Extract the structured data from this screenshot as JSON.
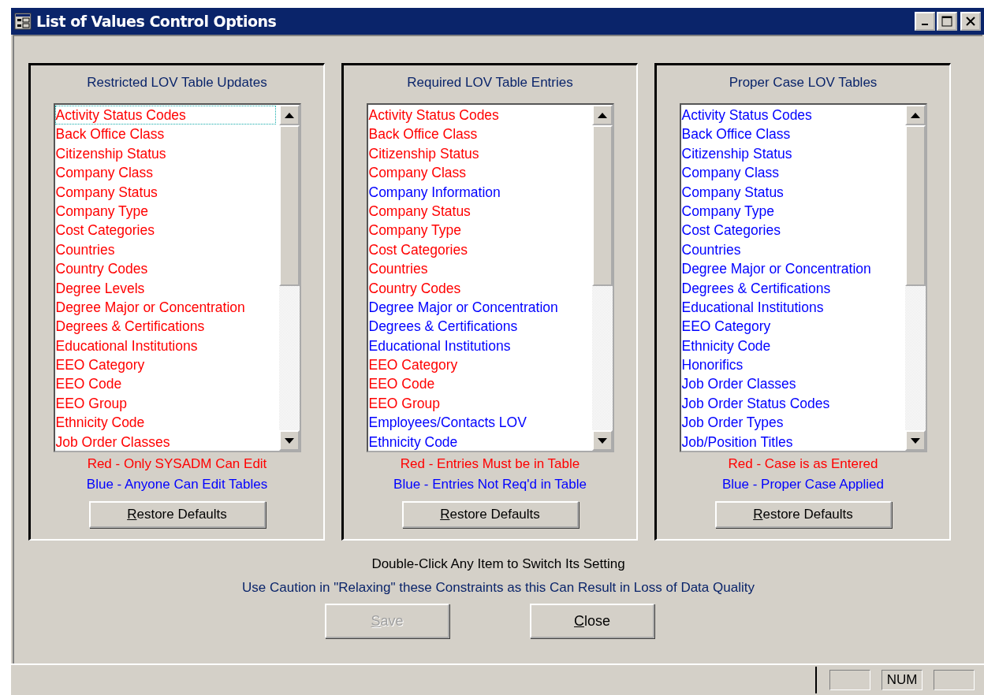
{
  "window": {
    "title": "List of Values Control Options"
  },
  "panels": [
    {
      "title": "Restricted LOV Table Updates",
      "items": [
        {
          "label": "Activity Status Codes",
          "color": "#ff0000",
          "focused": true
        },
        {
          "label": "Back Office Class",
          "color": "#ff0000",
          "focused": false
        },
        {
          "label": "Citizenship Status",
          "color": "#ff0000",
          "focused": false
        },
        {
          "label": "Company Class",
          "color": "#ff0000",
          "focused": false
        },
        {
          "label": "Company Status",
          "color": "#ff0000",
          "focused": false
        },
        {
          "label": "Company Type",
          "color": "#ff0000",
          "focused": false
        },
        {
          "label": "Cost Categories",
          "color": "#ff0000",
          "focused": false
        },
        {
          "label": "Countries",
          "color": "#ff0000",
          "focused": false
        },
        {
          "label": "Country Codes",
          "color": "#ff0000",
          "focused": false
        },
        {
          "label": "Degree Levels",
          "color": "#ff0000",
          "focused": false
        },
        {
          "label": "Degree Major or Concentration",
          "color": "#ff0000",
          "focused": false
        },
        {
          "label": "Degrees & Certifications",
          "color": "#ff0000",
          "focused": false
        },
        {
          "label": "Educational Institutions",
          "color": "#ff0000",
          "focused": false
        },
        {
          "label": "EEO Category",
          "color": "#ff0000",
          "focused": false
        },
        {
          "label": "EEO Code",
          "color": "#ff0000",
          "focused": false
        },
        {
          "label": "EEO Group",
          "color": "#ff0000",
          "focused": false
        },
        {
          "label": "Ethnicity Code",
          "color": "#ff0000",
          "focused": false
        },
        {
          "label": "Job Order Classes",
          "color": "#ff0000",
          "focused": false
        }
      ],
      "legend_red": "Red - Only SYSADM Can Edit",
      "legend_blue": "Blue - Anyone Can Edit Tables",
      "button": "Restore Defaults"
    },
    {
      "title": "Required LOV Table Entries",
      "items": [
        {
          "label": "Activity Status Codes",
          "color": "#ff0000",
          "focused": false
        },
        {
          "label": "Back Office Class",
          "color": "#ff0000",
          "focused": false
        },
        {
          "label": "Citizenship Status",
          "color": "#ff0000",
          "focused": false
        },
        {
          "label": "Company Class",
          "color": "#ff0000",
          "focused": false
        },
        {
          "label": "Company Information",
          "color": "#0000ff",
          "focused": false
        },
        {
          "label": "Company Status",
          "color": "#ff0000",
          "focused": false
        },
        {
          "label": "Company Type",
          "color": "#ff0000",
          "focused": false
        },
        {
          "label": "Cost Categories",
          "color": "#ff0000",
          "focused": false
        },
        {
          "label": "Countries",
          "color": "#ff0000",
          "focused": false
        },
        {
          "label": "Country Codes",
          "color": "#ff0000",
          "focused": false
        },
        {
          "label": "Degree Major or Concentration",
          "color": "#0000ff",
          "focused": false
        },
        {
          "label": "Degrees & Certifications",
          "color": "#0000ff",
          "focused": false
        },
        {
          "label": "Educational Institutions",
          "color": "#0000ff",
          "focused": false
        },
        {
          "label": "EEO Category",
          "color": "#ff0000",
          "focused": false
        },
        {
          "label": "EEO Code",
          "color": "#ff0000",
          "focused": false
        },
        {
          "label": "EEO Group",
          "color": "#ff0000",
          "focused": false
        },
        {
          "label": "Employees/Contacts LOV",
          "color": "#0000ff",
          "focused": false
        },
        {
          "label": "Ethnicity Code",
          "color": "#0000ff",
          "focused": false
        }
      ],
      "legend_red": "Red - Entries Must be in Table",
      "legend_blue": "Blue - Entries Not Req'd in Table",
      "button": "Restore Defaults"
    },
    {
      "title": "Proper Case LOV Tables",
      "items": [
        {
          "label": "Activity Status Codes",
          "color": "#0000ff",
          "focused": false
        },
        {
          "label": "Back Office Class",
          "color": "#0000ff",
          "focused": false
        },
        {
          "label": "Citizenship Status",
          "color": "#0000ff",
          "focused": false
        },
        {
          "label": "Company Class",
          "color": "#0000ff",
          "focused": false
        },
        {
          "label": "Company Status",
          "color": "#0000ff",
          "focused": false
        },
        {
          "label": "Company Type",
          "color": "#0000ff",
          "focused": false
        },
        {
          "label": "Cost Categories",
          "color": "#0000ff",
          "focused": false
        },
        {
          "label": "Countries",
          "color": "#0000ff",
          "focused": false
        },
        {
          "label": "Degree Major or Concentration",
          "color": "#0000ff",
          "focused": false
        },
        {
          "label": "Degrees & Certifications",
          "color": "#0000ff",
          "focused": false
        },
        {
          "label": "Educational Institutions",
          "color": "#0000ff",
          "focused": false
        },
        {
          "label": "EEO Category",
          "color": "#0000ff",
          "focused": false
        },
        {
          "label": "Ethnicity Code",
          "color": "#0000ff",
          "focused": false
        },
        {
          "label": "Honorifics",
          "color": "#0000ff",
          "focused": false
        },
        {
          "label": "Job Order Classes",
          "color": "#0000ff",
          "focused": false
        },
        {
          "label": "Job Order Status Codes",
          "color": "#0000ff",
          "focused": false
        },
        {
          "label": "Job Order Types",
          "color": "#0000ff",
          "focused": false
        },
        {
          "label": "Job/Position Titles",
          "color": "#0000ff",
          "focused": false
        }
      ],
      "legend_red": "Red - Case is as Entered",
      "legend_blue": "Blue - Proper Case Applied",
      "button": "Restore Defaults"
    }
  ],
  "instruction": "Double-Click Any Item to Switch Its Setting",
  "caution": "Use Caution in \"Relaxing\" these Constraints as this Can Result in Loss of Data Quality",
  "buttons": [
    {
      "label": "Save",
      "disabled": true
    },
    {
      "label": "Close",
      "disabled": false
    }
  ],
  "status_bar": {
    "panes": [
      {
        "kind": "empty"
      },
      {
        "kind": "text",
        "label": "NUM"
      },
      {
        "kind": "empty"
      }
    ]
  }
}
